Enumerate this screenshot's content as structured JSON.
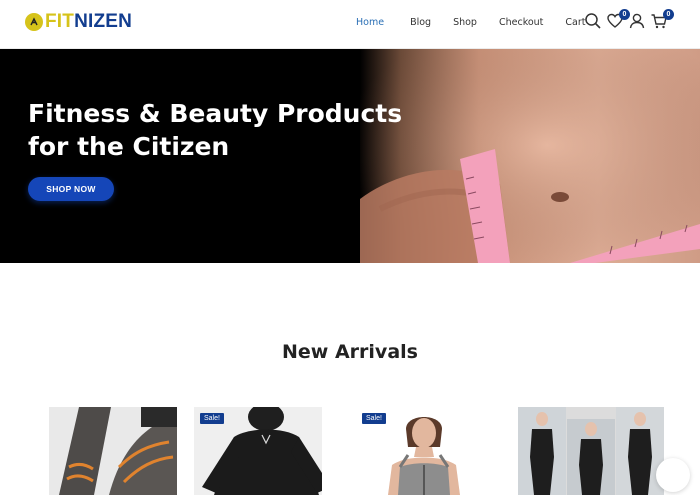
{
  "brand": {
    "part1": "FIT",
    "part2": "NIZEN",
    "colors": {
      "fit": "#d6c31a",
      "nizen": "#123d8f"
    }
  },
  "nav": [
    {
      "label": "Home",
      "active": true
    },
    {
      "label": "Blog",
      "active": false
    },
    {
      "label": "Shop",
      "active": false
    },
    {
      "label": "Checkout",
      "active": false
    },
    {
      "label": "Cart",
      "active": false
    }
  ],
  "header_icons": {
    "search": "search-icon",
    "wishlist": "heart-icon",
    "account": "user-icon",
    "cart": "cart-icon"
  },
  "counts": {
    "wishlist": "0",
    "cart": "0"
  },
  "hero": {
    "title_line1": "Fitness & Beauty Products",
    "title_line2": "for the Citizen",
    "button": "SHOP NOW",
    "accent": "#1546b8"
  },
  "new_arrivals": {
    "title": "New Arrivals",
    "products": [
      {
        "badge": ""
      },
      {
        "badge": "Sale!"
      },
      {
        "badge": "Sale!"
      },
      {
        "badge": ""
      }
    ]
  }
}
